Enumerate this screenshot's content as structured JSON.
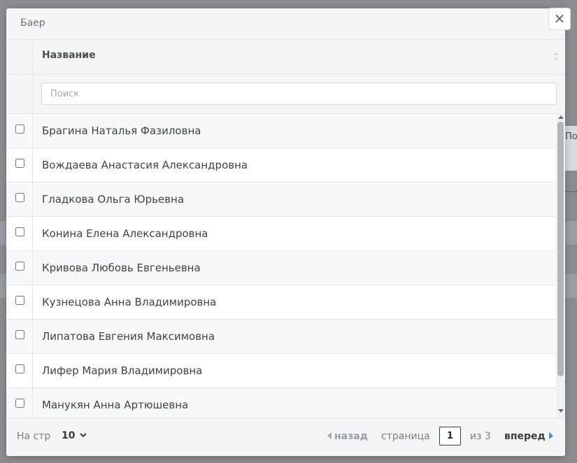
{
  "background": {
    "side_field_text": "По"
  },
  "modal": {
    "title": "Баер",
    "close_label": "×"
  },
  "table": {
    "column_header": "Название",
    "search_placeholder": "Поиск",
    "rows": [
      "Брагина Наталья Фазиловна",
      "Вождаева Анастасия Александровна",
      "Гладкова Ольга Юрьевна",
      "Конина Елена Александровна",
      "Кривова Любовь Евгеньевна",
      "Кузнецова Анна Владимировна",
      "Липатова Евгения Максимовна",
      "Лифер Мария Владимировна",
      "Манукян Анна Артюшевна"
    ]
  },
  "pagination": {
    "per_page_label": "На стр",
    "per_page_value": "10",
    "prev_label": "назад",
    "page_label": "страница",
    "current_page": "1",
    "of_label": "из 3",
    "next_label": "вперед"
  },
  "colors": {
    "accent": "#3c8fe0",
    "header_bg": "#f4f5f7",
    "overlay": "#8a8c8f"
  },
  "icons": {
    "close": "close-icon",
    "sort": "sort-icon",
    "prev": "triangle-left-icon",
    "next": "triangle-right-icon",
    "select": "chevron-down-icon"
  }
}
